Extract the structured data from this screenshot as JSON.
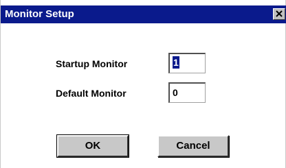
{
  "window": {
    "title": "Monitor Setup",
    "close_icon": "close-icon"
  },
  "fields": {
    "startup_label": "Startup Monitor",
    "startup_value": "1",
    "default_label": "Default Monitor",
    "default_value": "0"
  },
  "buttons": {
    "ok_label": "OK",
    "cancel_label": "Cancel"
  },
  "colors": {
    "titlebar": "#0a1a8c",
    "button_face": "#c8c8c8"
  }
}
